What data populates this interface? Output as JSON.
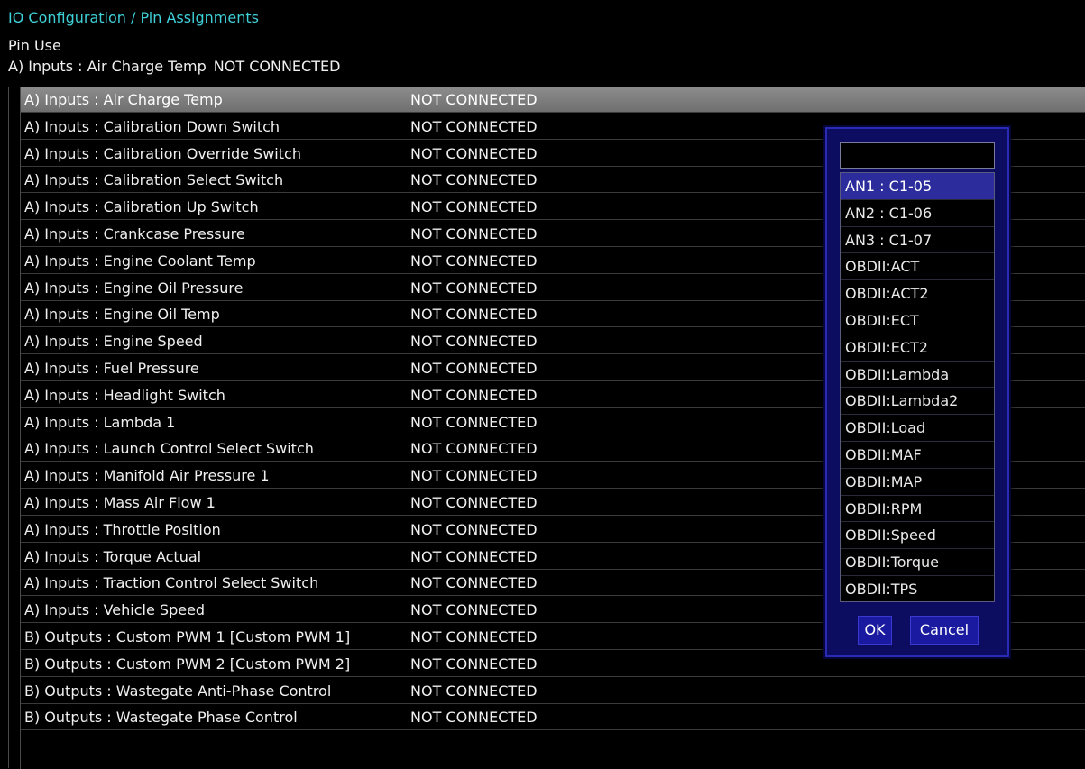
{
  "header": {
    "title": "IO Configuration / Pin Assignments",
    "pin_use_label": "Pin Use",
    "selected_name": "A) Inputs : Air Charge Temp",
    "selected_value": "NOT CONNECTED"
  },
  "table": {
    "rows": [
      {
        "name": "A) Inputs : Air Charge Temp",
        "value": "NOT CONNECTED"
      },
      {
        "name": "A) Inputs : Calibration Down Switch",
        "value": "NOT CONNECTED"
      },
      {
        "name": "A) Inputs : Calibration Override Switch",
        "value": "NOT CONNECTED"
      },
      {
        "name": "A) Inputs : Calibration Select Switch",
        "value": "NOT CONNECTED"
      },
      {
        "name": "A) Inputs : Calibration Up Switch",
        "value": "NOT CONNECTED"
      },
      {
        "name": "A) Inputs : Crankcase Pressure",
        "value": "NOT CONNECTED"
      },
      {
        "name": "A) Inputs : Engine Coolant Temp",
        "value": "NOT CONNECTED"
      },
      {
        "name": "A) Inputs : Engine Oil Pressure",
        "value": "NOT CONNECTED"
      },
      {
        "name": "A) Inputs : Engine Oil Temp",
        "value": "NOT CONNECTED"
      },
      {
        "name": "A) Inputs : Engine Speed",
        "value": "NOT CONNECTED"
      },
      {
        "name": "A) Inputs : Fuel Pressure",
        "value": "NOT CONNECTED"
      },
      {
        "name": "A) Inputs : Headlight Switch",
        "value": "NOT CONNECTED"
      },
      {
        "name": "A) Inputs : Lambda 1",
        "value": "NOT CONNECTED"
      },
      {
        "name": "A) Inputs : Launch Control Select Switch",
        "value": "NOT CONNECTED"
      },
      {
        "name": "A) Inputs : Manifold Air Pressure 1",
        "value": "NOT CONNECTED"
      },
      {
        "name": "A) Inputs : Mass Air Flow 1",
        "value": "NOT CONNECTED"
      },
      {
        "name": "A) Inputs : Throttle Position",
        "value": "NOT CONNECTED"
      },
      {
        "name": "A) Inputs : Torque Actual",
        "value": "NOT CONNECTED"
      },
      {
        "name": "A) Inputs : Traction Control Select Switch",
        "value": "NOT CONNECTED"
      },
      {
        "name": "A) Inputs : Vehicle Speed",
        "value": "NOT CONNECTED"
      },
      {
        "name": "B) Outputs : Custom PWM 1 [Custom PWM 1]",
        "value": "NOT CONNECTED"
      },
      {
        "name": "B) Outputs : Custom PWM 2 [Custom PWM 2]",
        "value": "NOT CONNECTED"
      },
      {
        "name": "B) Outputs : Wastegate Anti-Phase Control",
        "value": "NOT CONNECTED"
      },
      {
        "name": "B) Outputs : Wastegate Phase Control",
        "value": "NOT CONNECTED"
      }
    ]
  },
  "dialog": {
    "search_value": "",
    "options": [
      "AN1 : C1-05",
      "AN2 : C1-06",
      "AN3 : C1-07",
      "OBDII:ACT",
      "OBDII:ACT2",
      "OBDII:ECT",
      "OBDII:ECT2",
      "OBDII:Lambda",
      "OBDII:Lambda2",
      "OBDII:Load",
      "OBDII:MAF",
      "OBDII:MAP",
      "OBDII:RPM",
      "OBDII:Speed",
      "OBDII:Torque",
      "OBDII:TPS"
    ],
    "highlighted_option": "AN1 : C1-05",
    "ok_label": "OK",
    "cancel_label": "Cancel"
  },
  "colors": {
    "title": "#3fd0d8",
    "background": "#000000",
    "selected_row": "#7d7d7d",
    "dialog_bg": "#0c0c60",
    "dialog_highlight": "#2c2c9c"
  }
}
